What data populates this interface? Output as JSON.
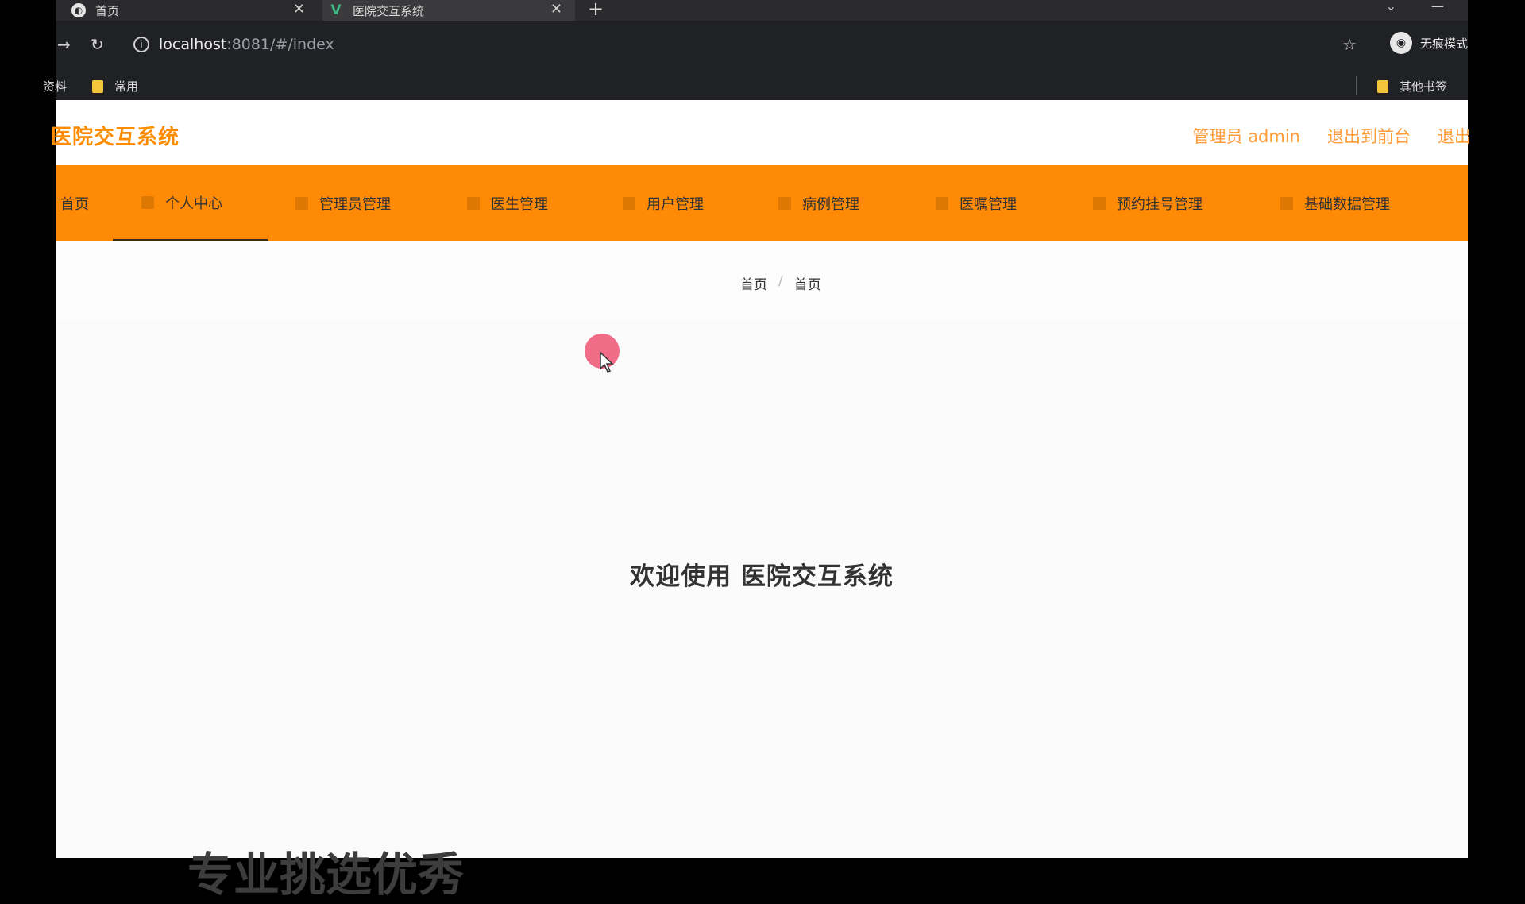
{
  "browser": {
    "tabs": [
      {
        "title": "首页",
        "active": false
      },
      {
        "title": "医院交互系统",
        "active": true
      }
    ],
    "url_host": "localhost",
    "url_rest": ":8081/#/index",
    "profile_label": "无痕模式",
    "bookmarks": {
      "left_partial": "资料",
      "common": "常用",
      "other": "其他书签"
    }
  },
  "header": {
    "brand": "医院交互系统",
    "admin_label": "管理员 admin",
    "to_frontend": "退出到前台",
    "logout_partial": "退出"
  },
  "menu": {
    "items": [
      {
        "label": "首页"
      },
      {
        "label": "个人中心"
      },
      {
        "label": "管理员管理"
      },
      {
        "label": "医生管理"
      },
      {
        "label": "用户管理"
      },
      {
        "label": "病例管理"
      },
      {
        "label": "医嘱管理"
      },
      {
        "label": "预约挂号管理"
      },
      {
        "label": "基础数据管理"
      }
    ]
  },
  "breadcrumb": {
    "level1": "首页",
    "separator": "/",
    "level2": "首页"
  },
  "main": {
    "welcome": "欢迎使用 医院交互系统",
    "partial_heading": "专业挑选优秀"
  },
  "colors": {
    "accent": "#ff8a05",
    "brand_text": "#ff8c00"
  }
}
